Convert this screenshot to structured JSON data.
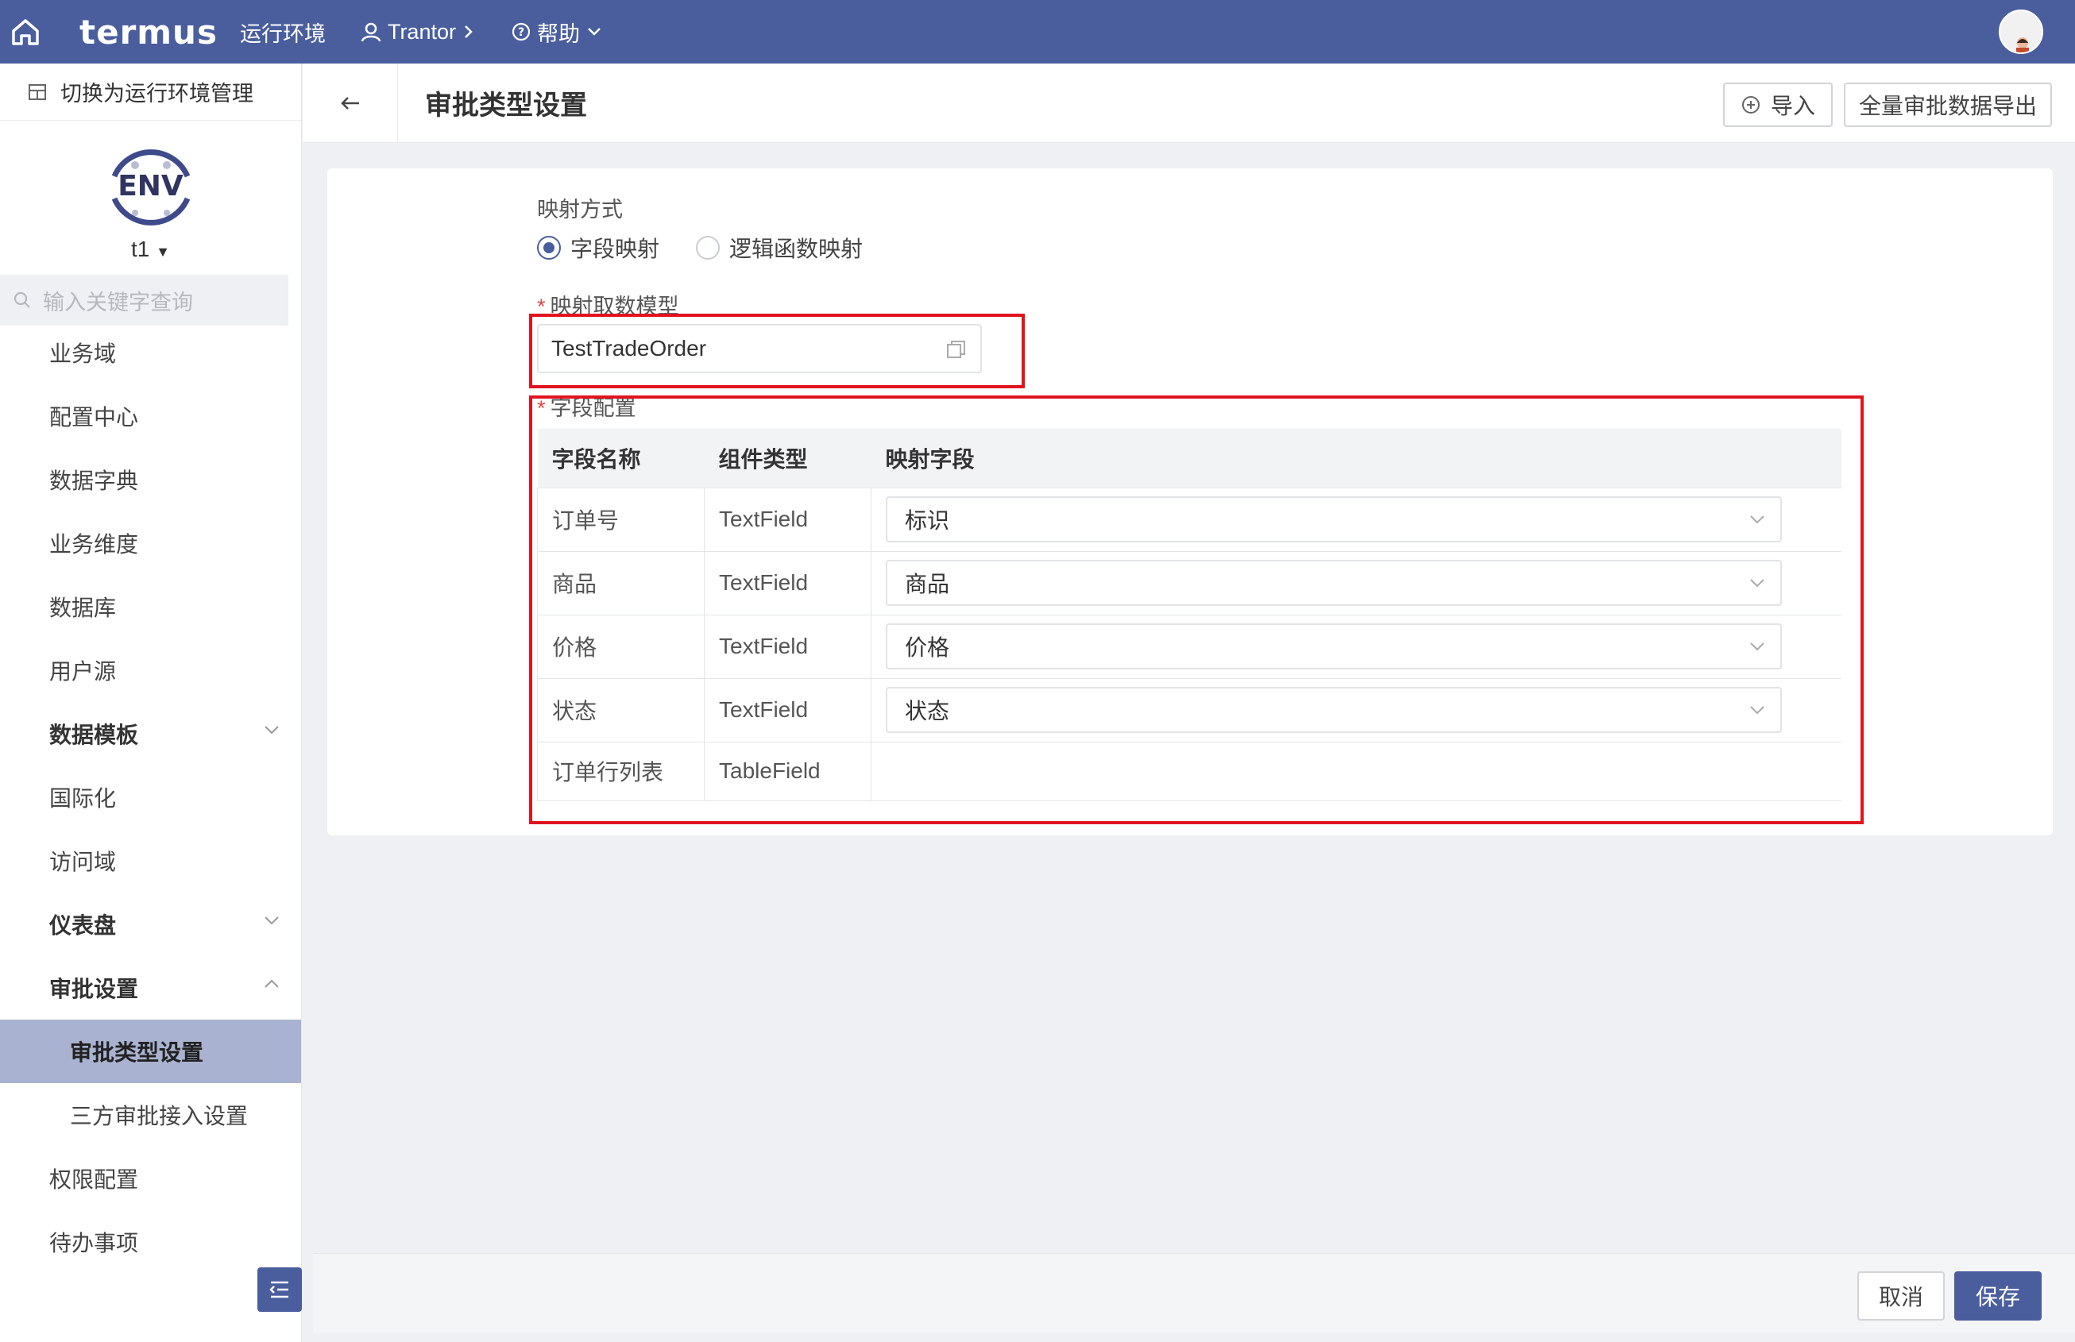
{
  "topbar": {
    "logo": "termus",
    "env_label": "运行环境",
    "project": "Trantor",
    "help": "帮助"
  },
  "sidebar": {
    "switch_label": "切换为运行环境管理",
    "env_logo_text": "ENV",
    "env_name": "t1",
    "search_placeholder": "输入关键字查询",
    "items": [
      {
        "label": "业务域"
      },
      {
        "label": "配置中心"
      },
      {
        "label": "数据字典"
      },
      {
        "label": "业务维度"
      },
      {
        "label": "数据库"
      },
      {
        "label": "用户源"
      },
      {
        "label": "数据模板"
      },
      {
        "label": "国际化"
      },
      {
        "label": "访问域"
      },
      {
        "label": "仪表盘"
      },
      {
        "label": "审批设置"
      },
      {
        "label": "审批类型设置"
      },
      {
        "label": "三方审批接入设置"
      },
      {
        "label": "权限配置"
      },
      {
        "label": "待办事项"
      }
    ]
  },
  "header": {
    "title": "审批类型设置",
    "import_label": "导入",
    "export_label": "全量审批数据导出"
  },
  "form": {
    "mapping_mode_label": "映射方式",
    "mode_field": "字段映射",
    "mode_logic": "逻辑函数映射",
    "model_label": "映射取数模型",
    "model_value": "TestTradeOrder",
    "field_config_label": "字段配置",
    "columns": [
      "字段名称",
      "组件类型",
      "映射字段"
    ],
    "rows": [
      {
        "name": "订单号",
        "type": "TextField",
        "mapped": "标识"
      },
      {
        "name": "商品",
        "type": "TextField",
        "mapped": "商品"
      },
      {
        "name": "价格",
        "type": "TextField",
        "mapped": "价格"
      },
      {
        "name": "状态",
        "type": "TextField",
        "mapped": "状态"
      },
      {
        "name": "订单行列表",
        "type": "TableField",
        "mapped": ""
      }
    ]
  },
  "footer": {
    "cancel_label": "取消",
    "save_label": "保存"
  }
}
